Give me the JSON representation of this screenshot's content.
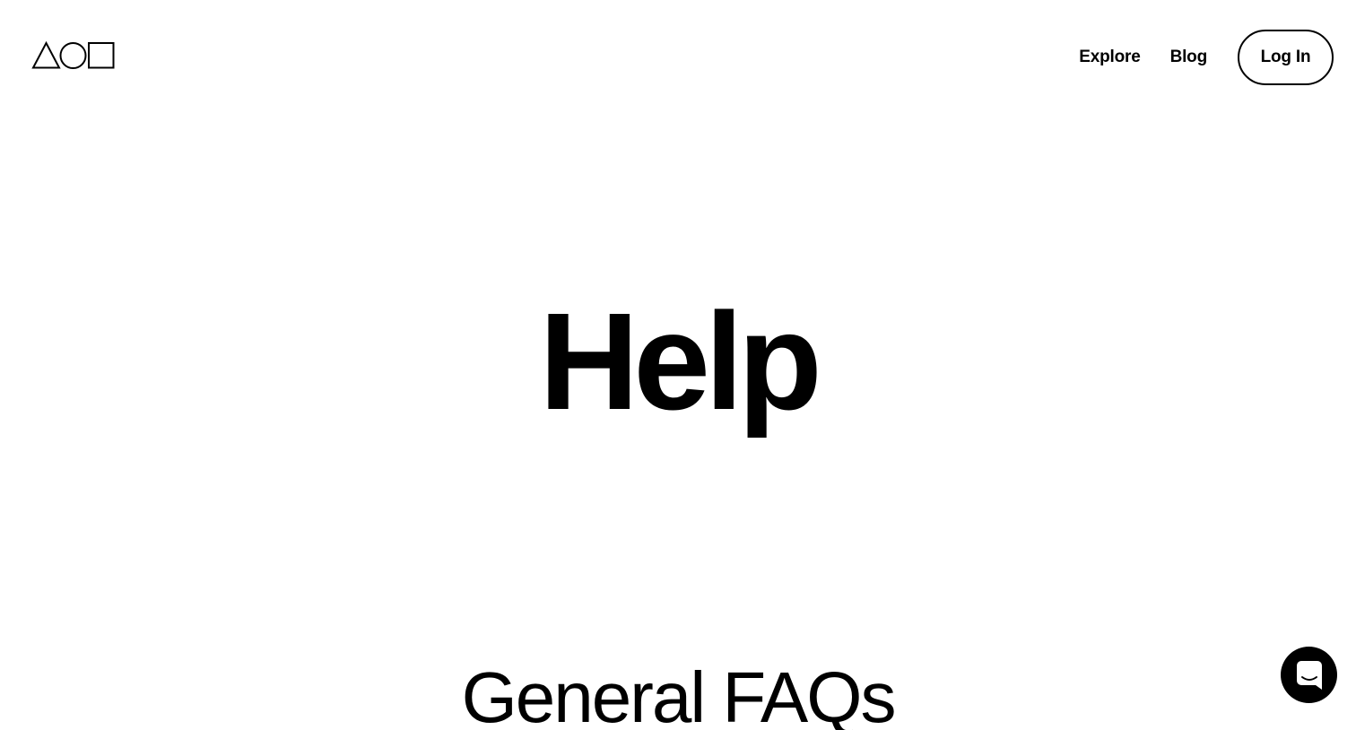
{
  "header": {
    "logo_icon": "triangle-circle-square-logo-icon",
    "nav": {
      "explore_label": "Explore",
      "blog_label": "Blog",
      "login_label": "Log In"
    }
  },
  "main": {
    "title": "Help",
    "section_title": "General FAQs"
  },
  "chat": {
    "icon": "chat-bubble-icon"
  },
  "colors": {
    "background": "#ffffff",
    "foreground": "#000000"
  }
}
